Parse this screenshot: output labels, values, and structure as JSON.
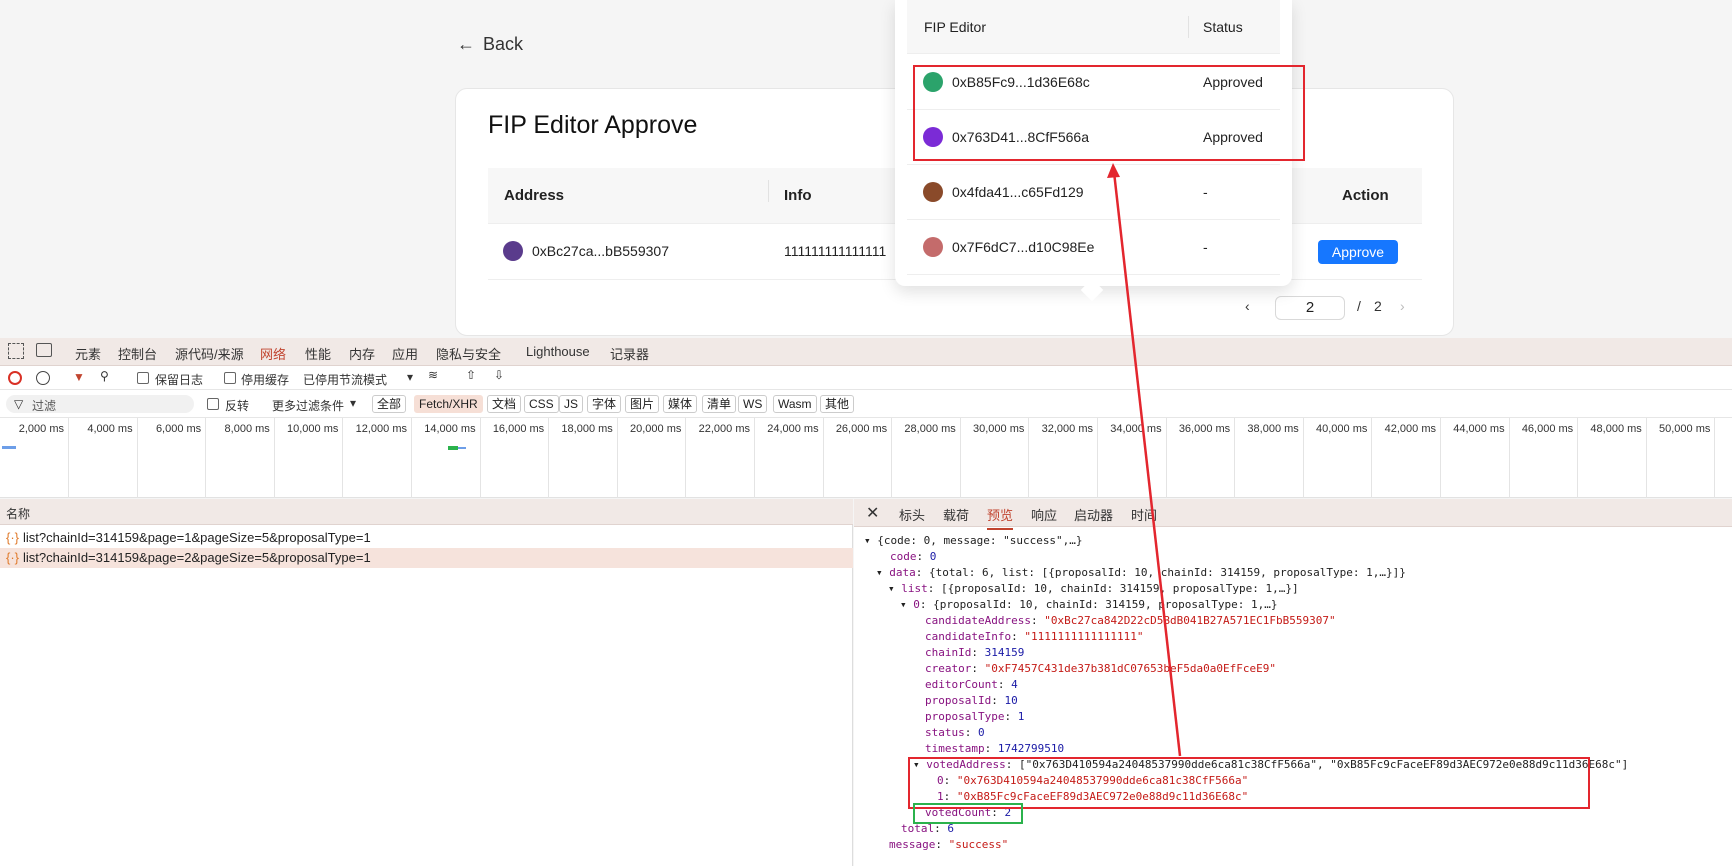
{
  "app": {
    "back_label": "Back",
    "card_title": "FIP Editor Approve",
    "columns": {
      "address": "Address",
      "info": "Info",
      "action": "Action"
    },
    "row": {
      "address": "0xBc27ca...bB559307",
      "info": "111111111111111",
      "action_label": "Approve"
    },
    "pagination": {
      "current": "2",
      "separator": "/",
      "total": "2"
    }
  },
  "popover": {
    "headers": {
      "editor": "FIP Editor",
      "status": "Status"
    },
    "rows": [
      {
        "address": "0xB85Fc9...1d36E68c",
        "status": "Approved",
        "color": "#2ba36b"
      },
      {
        "address": "0x763D41...8CfF566a",
        "status": "Approved",
        "color": "#7b2bd6"
      },
      {
        "address": "0x4fda41...c65Fd129",
        "status": "-",
        "color": "#8a4a2a"
      },
      {
        "address": "0x7F6dC7...d10C98Ee",
        "status": "-",
        "color": "#c46b6b"
      }
    ]
  },
  "devtools": {
    "tabs": [
      "元素",
      "控制台",
      "源代码/来源",
      "网络",
      "性能",
      "内存",
      "应用",
      "隐私与安全",
      "Lighthouse",
      "记录器"
    ],
    "active_tab": "网络",
    "toolbar": {
      "preserve_log": "保留日志",
      "disable_cache": "停用缓存",
      "throttle": "已停用节流模式"
    },
    "filter": {
      "placeholder": "过滤",
      "invert": "反转",
      "more_filters": "更多过滤条件"
    },
    "chips": [
      "全部",
      "Fetch/XHR",
      "文档",
      "CSS",
      "JS",
      "字体",
      "图片",
      "媒体",
      "清单",
      "WS",
      "Wasm",
      "其他"
    ],
    "active_chip": "Fetch/XHR",
    "timeline_ticks": [
      "2,000 ms",
      "4,000 ms",
      "6,000 ms",
      "8,000 ms",
      "10,000 ms",
      "12,000 ms",
      "14,000 ms",
      "16,000 ms",
      "18,000 ms",
      "20,000 ms",
      "22,000 ms",
      "24,000 ms",
      "26,000 ms",
      "28,000 ms",
      "30,000 ms",
      "32,000 ms",
      "34,000 ms",
      "36,000 ms",
      "38,000 ms",
      "40,000 ms",
      "42,000 ms",
      "44,000 ms",
      "46,000 ms",
      "48,000 ms",
      "50,000 ms"
    ],
    "name_header": "名称",
    "requests": [
      "list?chainId=314159&page=1&pageSize=5&proposalType=1",
      "list?chainId=314159&page=2&pageSize=5&proposalType=1"
    ],
    "detail_tabs": [
      "标头",
      "载荷",
      "预览",
      "响应",
      "启动器",
      "时间"
    ],
    "active_detail_tab": "预览",
    "preview": {
      "l1": "{code: 0, message: \"success\",…}",
      "code": "0",
      "data_summary": "{total: 6, list: [{proposalId: 10, chainId: 314159, proposalType: 1,…}]}",
      "list_summary": "[{proposalId: 10, chainId: 314159, proposalType: 1,…}]",
      "item_summary": "{proposalId: 10, chainId: 314159, proposalType: 1,…}",
      "candidateAddress": "\"0xBc27ca842D22cD5BdB041B27A571EC1FbB559307\"",
      "candidateInfo": "\"1111111111111111\"",
      "chainId": "314159",
      "creator": "\"0xF7457C431de37b381dC07653beF5da0a0EfFceE9\"",
      "editorCount": "4",
      "proposalId": "10",
      "proposalType": "1",
      "status": "0",
      "timestamp": "1742799510",
      "votedAddress": "[\"0x763D410594a24048537990dde6ca81c38CfF566a\", \"0xB85Fc9cFaceEF89d3AEC972e0e88d9c11d36E68c\"]",
      "voted0": "\"0x763D410594a24048537990dde6ca81c38CfF566a\"",
      "voted1": "\"0xB85Fc9cFaceEF89d3AEC972e0e88d9c11d36E68c\"",
      "votedCount": "2",
      "total": "6",
      "message": "\"success\""
    }
  }
}
